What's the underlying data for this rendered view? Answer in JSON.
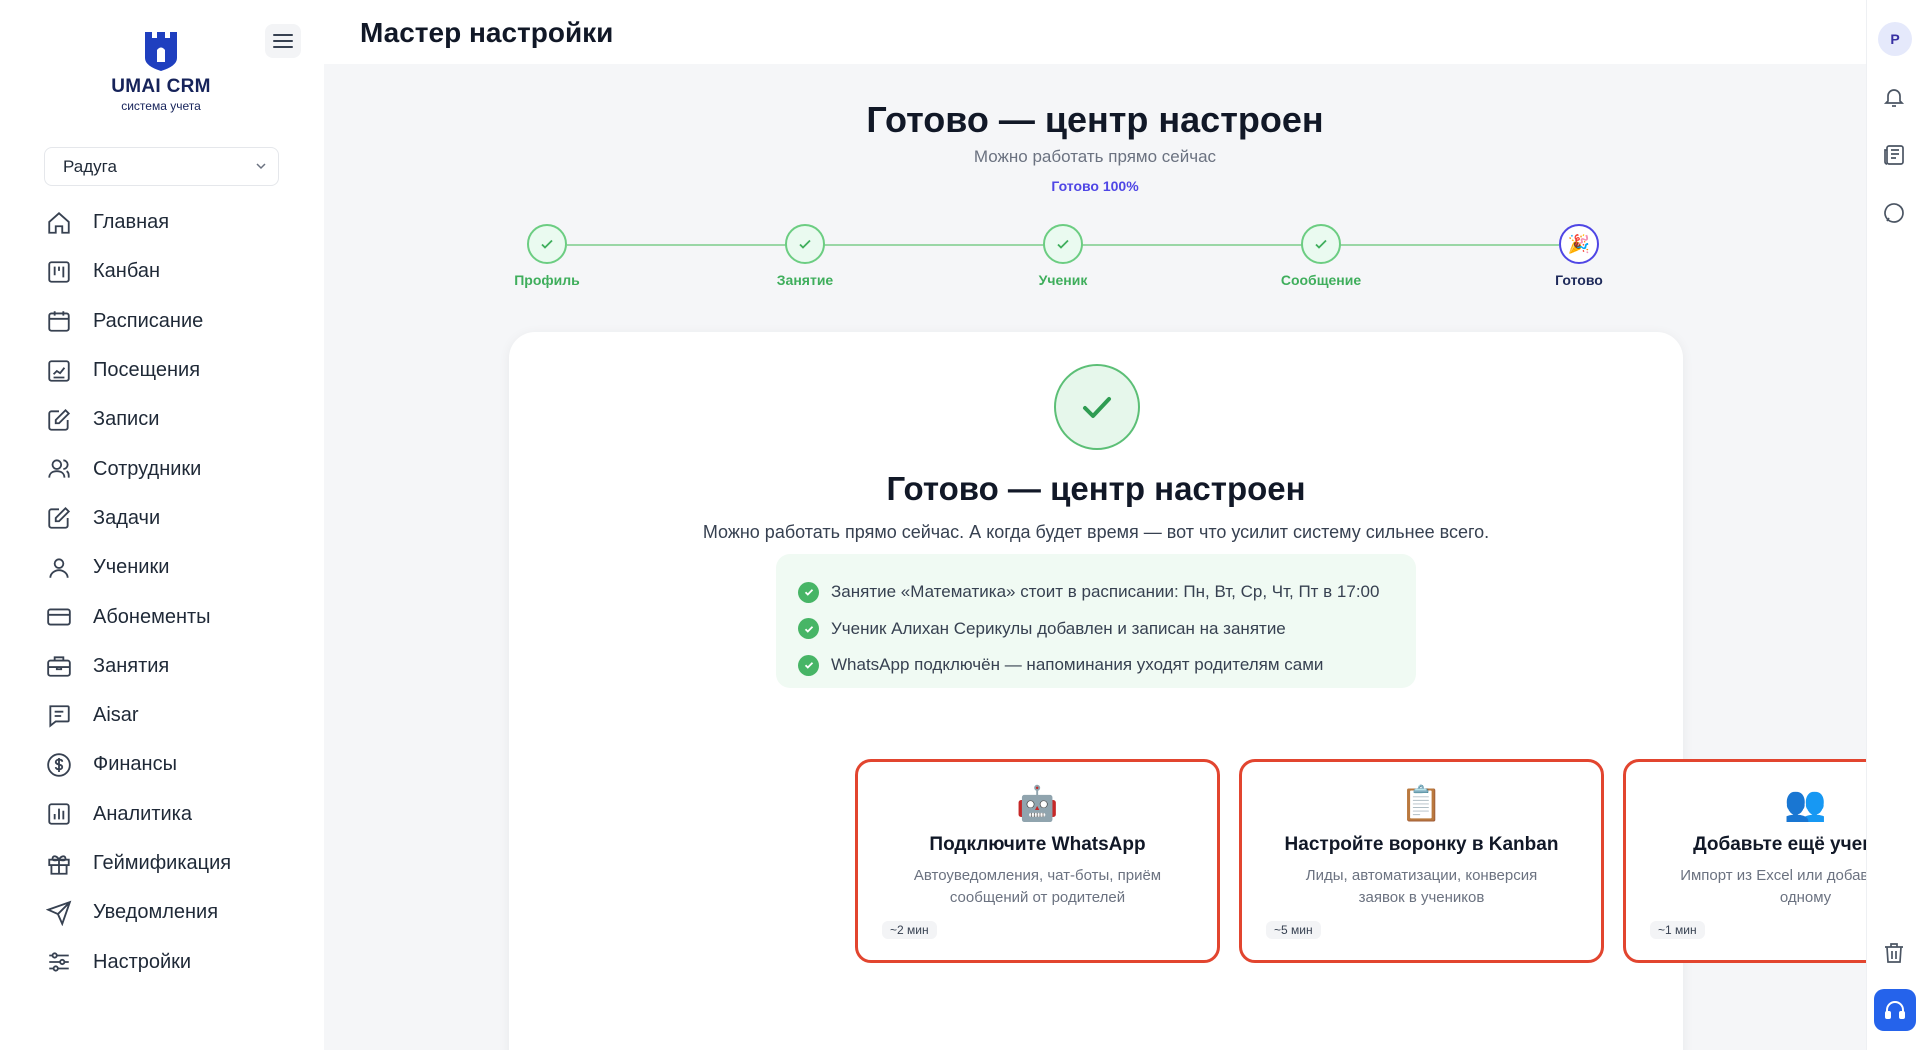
{
  "app": {
    "logo_title": "UMAI CRM",
    "logo_subtitle": "система учета",
    "brand_color": "#16235a"
  },
  "sidebar": {
    "branch": "Радуга",
    "items": [
      {
        "label": "Главная",
        "icon": "home-icon"
      },
      {
        "label": "Канбан",
        "icon": "kanban-icon"
      },
      {
        "label": "Расписание",
        "icon": "calendar-icon"
      },
      {
        "label": "Посещения",
        "icon": "chart-box-icon"
      },
      {
        "label": "Записи",
        "icon": "edit-icon"
      },
      {
        "label": "Сотрудники",
        "icon": "users-icon"
      },
      {
        "label": "Задачи",
        "icon": "edit-icon"
      },
      {
        "label": "Ученики",
        "icon": "user-icon"
      },
      {
        "label": "Абонементы",
        "icon": "credit-card-icon"
      },
      {
        "label": "Занятия",
        "icon": "briefcase-icon"
      },
      {
        "label": "Aisar",
        "icon": "message-icon"
      },
      {
        "label": "Финансы",
        "icon": "dollar-icon"
      },
      {
        "label": "Аналитика",
        "icon": "bar-chart-icon"
      },
      {
        "label": "Геймификация",
        "icon": "gift-icon"
      },
      {
        "label": "Уведомления",
        "icon": "send-icon"
      },
      {
        "label": "Настройки",
        "icon": "sliders-icon"
      }
    ]
  },
  "header": {
    "title": "Мастер настройки"
  },
  "hero": {
    "title": "Готово — центр настроен",
    "subtitle": "Можно работать прямо сейчас",
    "progress_label": "Готово 100%",
    "progress_value": 1.0
  },
  "stepper": {
    "steps": [
      {
        "label": "Профиль",
        "status": "done"
      },
      {
        "label": "Занятие",
        "status": "done"
      },
      {
        "label": "Ученик",
        "status": "done"
      },
      {
        "label": "Сообщение",
        "status": "done"
      },
      {
        "label": "Готово",
        "status": "current",
        "icon": "🎉"
      }
    ]
  },
  "card": {
    "title": "Готово — центр настроен",
    "subtitle": "Можно работать прямо сейчас. А когда будет время — вот что усилит систему сильнее всего.",
    "checklist": [
      "Занятие «Математика» стоит в расписании: Пн, Вт, Ср, Чт, Пт в 17:00",
      "Ученик Алихан Серикулы добавлен и записан на занятие",
      "WhatsApp подключён — напоминания уходят родителям сами"
    ],
    "actions": [
      {
        "emoji": "🤖",
        "title": "Подключите WhatsApp",
        "description": "Автоуведомления, чат-боты, приём сообщений от родителей",
        "time": "~2 мин"
      },
      {
        "emoji": "📋",
        "title": "Настройте воронку в Kanban",
        "description": "Лиды, автоматизации, конверсия заявок в учеников",
        "time": "~5 мин"
      },
      {
        "emoji": "👥",
        "title": "Добавьте ещё учеников",
        "description": "Импорт из Excel или добавление по одному",
        "time": "~1 мин"
      }
    ]
  },
  "rail": {
    "avatar_initial": "P",
    "icons": [
      "bell-icon",
      "newspaper-icon",
      "chat-icon",
      "trash-icon",
      "headset-icon"
    ]
  },
  "colors": {
    "success": "#47b566",
    "accent": "#4f46e5",
    "highlight_border": "#e2452f",
    "support": "#2563eb"
  }
}
